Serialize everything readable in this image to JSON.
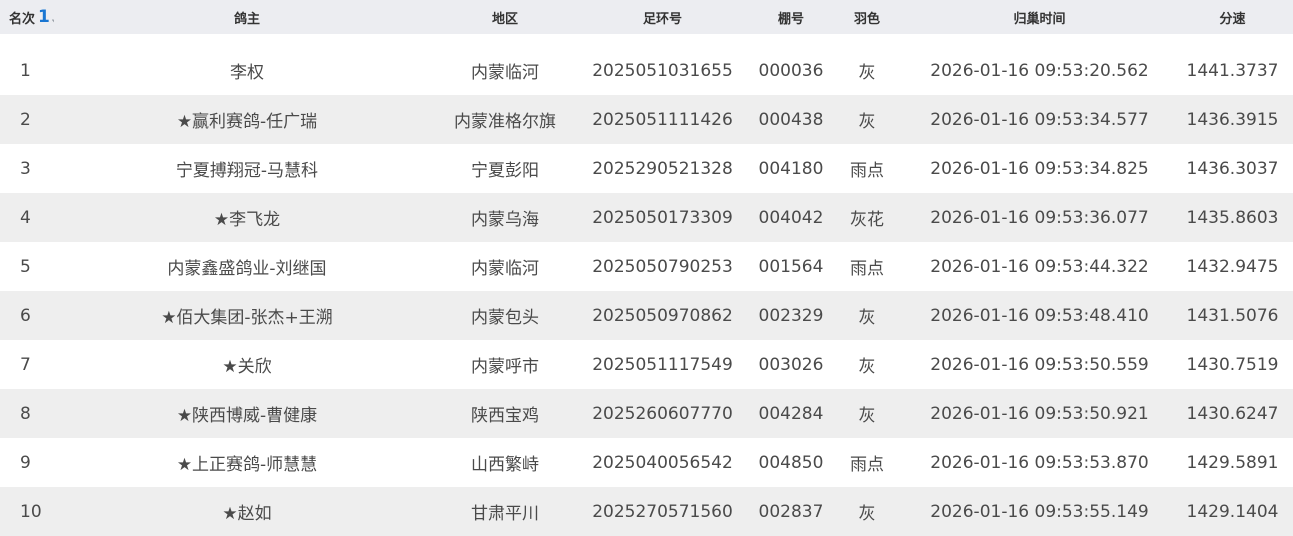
{
  "header": {
    "rank": "名次",
    "sort_order": "1",
    "owner": "鸽主",
    "region": "地区",
    "ring": "足环号",
    "shed": "棚号",
    "color": "羽色",
    "time": "归巢时间",
    "speed": "分速"
  },
  "rows": [
    {
      "rank": "1",
      "owner": "李权",
      "region": "内蒙临河",
      "ring": "2025051031655",
      "shed": "000036",
      "color": "灰",
      "time": "2026-01-16 09:53:20.562",
      "speed": "1441.3737"
    },
    {
      "rank": "2",
      "owner": "★赢利赛鸽-任广瑞",
      "region": "内蒙准格尔旗",
      "ring": "2025051111426",
      "shed": "000438",
      "color": "灰",
      "time": "2026-01-16 09:53:34.577",
      "speed": "1436.3915"
    },
    {
      "rank": "3",
      "owner": "宁夏搏翔冠-马慧科",
      "region": "宁夏彭阳",
      "ring": "2025290521328",
      "shed": "004180",
      "color": "雨点",
      "time": "2026-01-16 09:53:34.825",
      "speed": "1436.3037"
    },
    {
      "rank": "4",
      "owner": "★李飞龙",
      "region": "内蒙乌海",
      "ring": "2025050173309",
      "shed": "004042",
      "color": "灰花",
      "time": "2026-01-16 09:53:36.077",
      "speed": "1435.8603"
    },
    {
      "rank": "5",
      "owner": "内蒙鑫盛鸽业-刘继国",
      "region": "内蒙临河",
      "ring": "2025050790253",
      "shed": "001564",
      "color": "雨点",
      "time": "2026-01-16 09:53:44.322",
      "speed": "1432.9475"
    },
    {
      "rank": "6",
      "owner": "★佰大集团-张杰+王溯",
      "region": "内蒙包头",
      "ring": "2025050970862",
      "shed": "002329",
      "color": "灰",
      "time": "2026-01-16 09:53:48.410",
      "speed": "1431.5076"
    },
    {
      "rank": "7",
      "owner": "★关欣",
      "region": "内蒙呼市",
      "ring": "2025051117549",
      "shed": "003026",
      "color": "灰",
      "time": "2026-01-16 09:53:50.559",
      "speed": "1430.7519"
    },
    {
      "rank": "8",
      "owner": "★陕西博威-曹健康",
      "region": "陕西宝鸡",
      "ring": "2025260607770",
      "shed": "004284",
      "color": "灰",
      "time": "2026-01-16 09:53:50.921",
      "speed": "1430.6247"
    },
    {
      "rank": "9",
      "owner": "★上正赛鸽-师慧慧",
      "region": "山西繁峙",
      "ring": "2025040056542",
      "shed": "004850",
      "color": "雨点",
      "time": "2026-01-16 09:53:53.870",
      "speed": "1429.5891"
    },
    {
      "rank": "10",
      "owner": "★赵如",
      "region": "甘肃平川",
      "ring": "2025270571560",
      "shed": "002837",
      "color": "灰",
      "time": "2026-01-16 09:53:55.149",
      "speed": "1429.1404"
    }
  ],
  "colors": {
    "header_bg": "#ecedf1",
    "row_alt_bg": "#eeeeee",
    "sort_accent": "#1976d2",
    "text": "#4a4a4a"
  },
  "icons": {
    "sort": "sort-arrows-icon"
  }
}
